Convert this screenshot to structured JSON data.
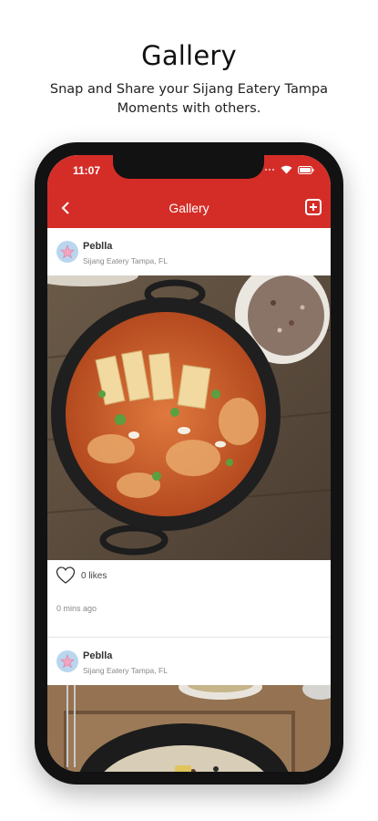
{
  "promo": {
    "title": "Gallery",
    "subtitle": "Snap and Share your Sijang Eatery Tampa Moments with others."
  },
  "status_bar": {
    "time": "11:07"
  },
  "app_bar": {
    "title": "Gallery",
    "back_icon": "chevron-left-icon",
    "add_icon": "add-box-icon"
  },
  "posts": [
    {
      "user": "Peblla",
      "location": "Sijang Eatery Tampa, FL",
      "likes": "0 likes",
      "time": "0 mins ago"
    },
    {
      "user": "Peblla",
      "location": "Sijang Eatery Tampa, FL"
    }
  ],
  "colors": {
    "accent": "#d42d27",
    "phone_frame": "#121212"
  }
}
